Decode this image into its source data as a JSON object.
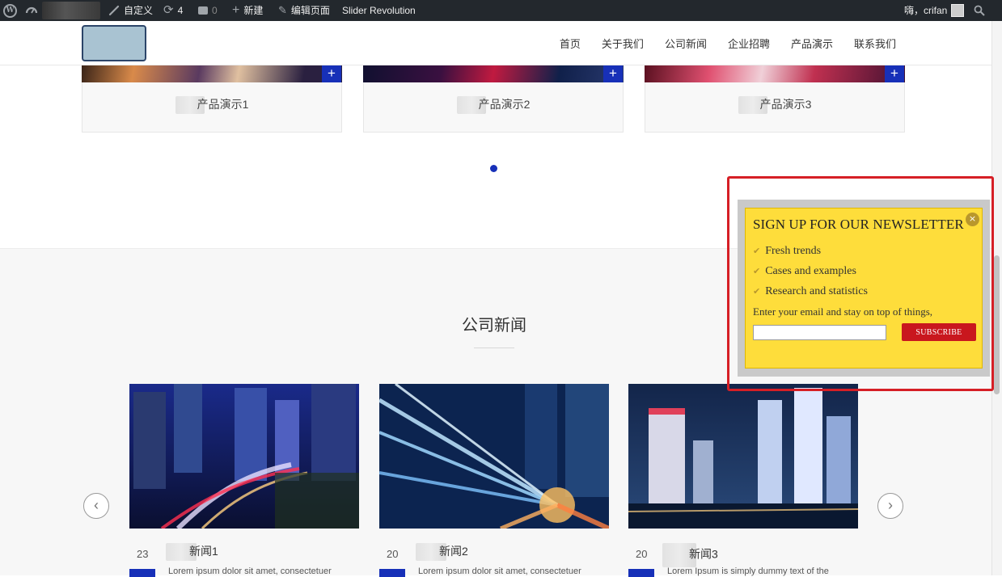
{
  "admin_bar": {
    "customize": "自定义",
    "updates_count": "4",
    "comments_count": "0",
    "new_label": "新建",
    "edit_page": "编辑页面",
    "slider_revolution": "Slider Revolution",
    "greeting": "嗨，crifan"
  },
  "nav": {
    "items": [
      "首页",
      "关于我们",
      "公司新闻",
      "企业招聘",
      "产品演示",
      "联系我们"
    ]
  },
  "products": [
    {
      "title": "产品演示1"
    },
    {
      "title": "产品演示2"
    },
    {
      "title": "产品演示3"
    }
  ],
  "news": {
    "heading": "公司新闻",
    "items": [
      {
        "day": "23",
        "title": "新闻1",
        "excerpt": "Lorem ipsum dolor sit amet, consectetuer"
      },
      {
        "day": "20",
        "title": "新闻2",
        "excerpt": "Lorem ipsum dolor sit amet, consectetuer"
      },
      {
        "day": "20",
        "title": "新闻3",
        "excerpt": "Lorem Ipsum is simply dummy text of the"
      }
    ]
  },
  "newsletter": {
    "title": "SIGN UP FOR OUR NEWSLETTER",
    "bullets": [
      "Fresh trends",
      "Cases and examples",
      "Research and statistics"
    ],
    "hint": "Enter your email and stay on top of things,",
    "email_value": "",
    "subscribe_label": "SUBSCRIBE"
  },
  "colors": {
    "accent_blue": "#1730b8",
    "popup_yellow": "#fedd3b",
    "subscribe_red": "#c9171e",
    "highlight_red": "#d61f26"
  }
}
